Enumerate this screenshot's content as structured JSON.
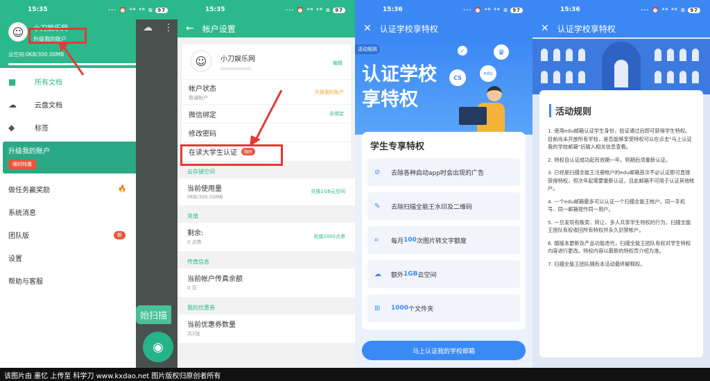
{
  "status": {
    "panels": [
      {
        "time": "15:35",
        "battery": "97"
      },
      {
        "time": "15:35",
        "battery": "97"
      },
      {
        "time": "15:36",
        "battery": "97"
      },
      {
        "time": "15:36",
        "battery": "97"
      }
    ],
    "signal_icons": "··· ⏰ ⁴ᴳ ⁴ᴳ ≋"
  },
  "drawer": {
    "username": "小刀娱乐网",
    "upgrade_link": "升级我的账户",
    "storage": "云空间:0KB/300.00MB",
    "upgrade_button": "升级",
    "menu": [
      {
        "label": "所有文档",
        "icon": "folder-icon"
      },
      {
        "label": "云盘文档",
        "icon": "cloud-icon"
      },
      {
        "label": "标签",
        "icon": "tag-icon"
      }
    ],
    "upgrade_box": {
      "title": "升级我的账户",
      "tag": "限时特惠"
    },
    "menu2": [
      {
        "label": "做任务赢奖励",
        "badge": "🔥"
      },
      {
        "label": "系统消息",
        "badge": ""
      },
      {
        "label": "团队版",
        "badge": "新"
      },
      {
        "label": "设置",
        "badge": ""
      },
      {
        "label": "帮助与客服",
        "badge": ""
      }
    ],
    "scan_label": "始扫描"
  },
  "account": {
    "title": "帐户设置",
    "username": "小刀娱乐网",
    "edit": "编辑",
    "rows": [
      {
        "label": "帐户状态",
        "sub": "普通帐户",
        "action": "升级我的账户"
      },
      {
        "label": "微信绑定",
        "sub": "",
        "action": "去绑定"
      },
      {
        "label": "修改密码",
        "sub": "",
        "action": ""
      },
      {
        "label": "在读大学生认证",
        "sub": "",
        "tag": "限时"
      }
    ],
    "sections": [
      {
        "head": "云存储空间",
        "label": "当前使用量",
        "sub": "0KB/300.00MB",
        "action": "兑换1GB云空间"
      },
      {
        "head": "充值",
        "label": "剩余:",
        "sub": "0 点券",
        "action": "充值2000点券"
      },
      {
        "head": "传真信息",
        "label": "当前帐户传真余额",
        "sub": "0 页",
        "action": ""
      },
      {
        "head": "我的优惠券",
        "label": "当前优惠券数量",
        "sub": "共2张",
        "action": ""
      }
    ]
  },
  "privilege": {
    "title": "认证学校享特权",
    "rule_tag": "活动规则",
    "banner_line1": "认证学校",
    "banner_line2": "享特权",
    "bubble1": "CS",
    "bubble2": "edu",
    "card_title": "学生专享特权",
    "items": [
      {
        "icon": "ad-free-icon",
        "pre": "",
        "bold": "",
        "text": "去除各种启动app时会出现的广告"
      },
      {
        "icon": "eraser-icon",
        "pre": "",
        "bold": "",
        "text": "去除扫描全能王水印及二维码"
      },
      {
        "icon": "ocr-icon",
        "pre": "每月",
        "bold": "100",
        "text": "次图片转文字额度"
      },
      {
        "icon": "cloud-upload-icon",
        "pre": "额外",
        "bold": "1GB",
        "text": "云空间"
      },
      {
        "icon": "folder-plus-icon",
        "pre": "",
        "bold": "1000",
        "text": "个文件夹"
      }
    ],
    "cta": "马上认证我的学校邮箱"
  },
  "rules": {
    "title": "认证学校享特权",
    "heading": "活动规则",
    "paragraphs": [
      "1. 使用edu邮箱认证学生身份，验证通过后即可获得学生特权。目前尚未开放所有学校，是否能够享受特权可以在点击\"马上认证我的学校邮箱\"后输入相关信息查看。",
      "2. 特权自认证成功起有效期一年。到期后须重新认证。",
      "3. 已经是扫描全能王注册帐户的edu邮箱首次不必认证即可直接获得特权，但次年起需要重新认证，且此邮箱不可用于认证其他帐户。",
      "4. 一个edu邮箱最多可以认证一个扫描全能王帐户。同一手机号、同一邮箱视作同一用户。",
      "5. 一旦发现有贩卖、转让、多人共享学生特权的行为，扫描全能王团队有权收回所有特权并永久封禁帐户。",
      "6. 随版本更新及产品功能迭代，扫描全能王团队有权对学生特权内容进行更改。特权内容以最新的特权页介绍为准。",
      "7. 扫描全能王团队拥有本活动最终解释权。"
    ]
  },
  "footer": "该图片由 墨忆 上传至 科学刀 www.kxdao.net 图片版权归原创者所有"
}
